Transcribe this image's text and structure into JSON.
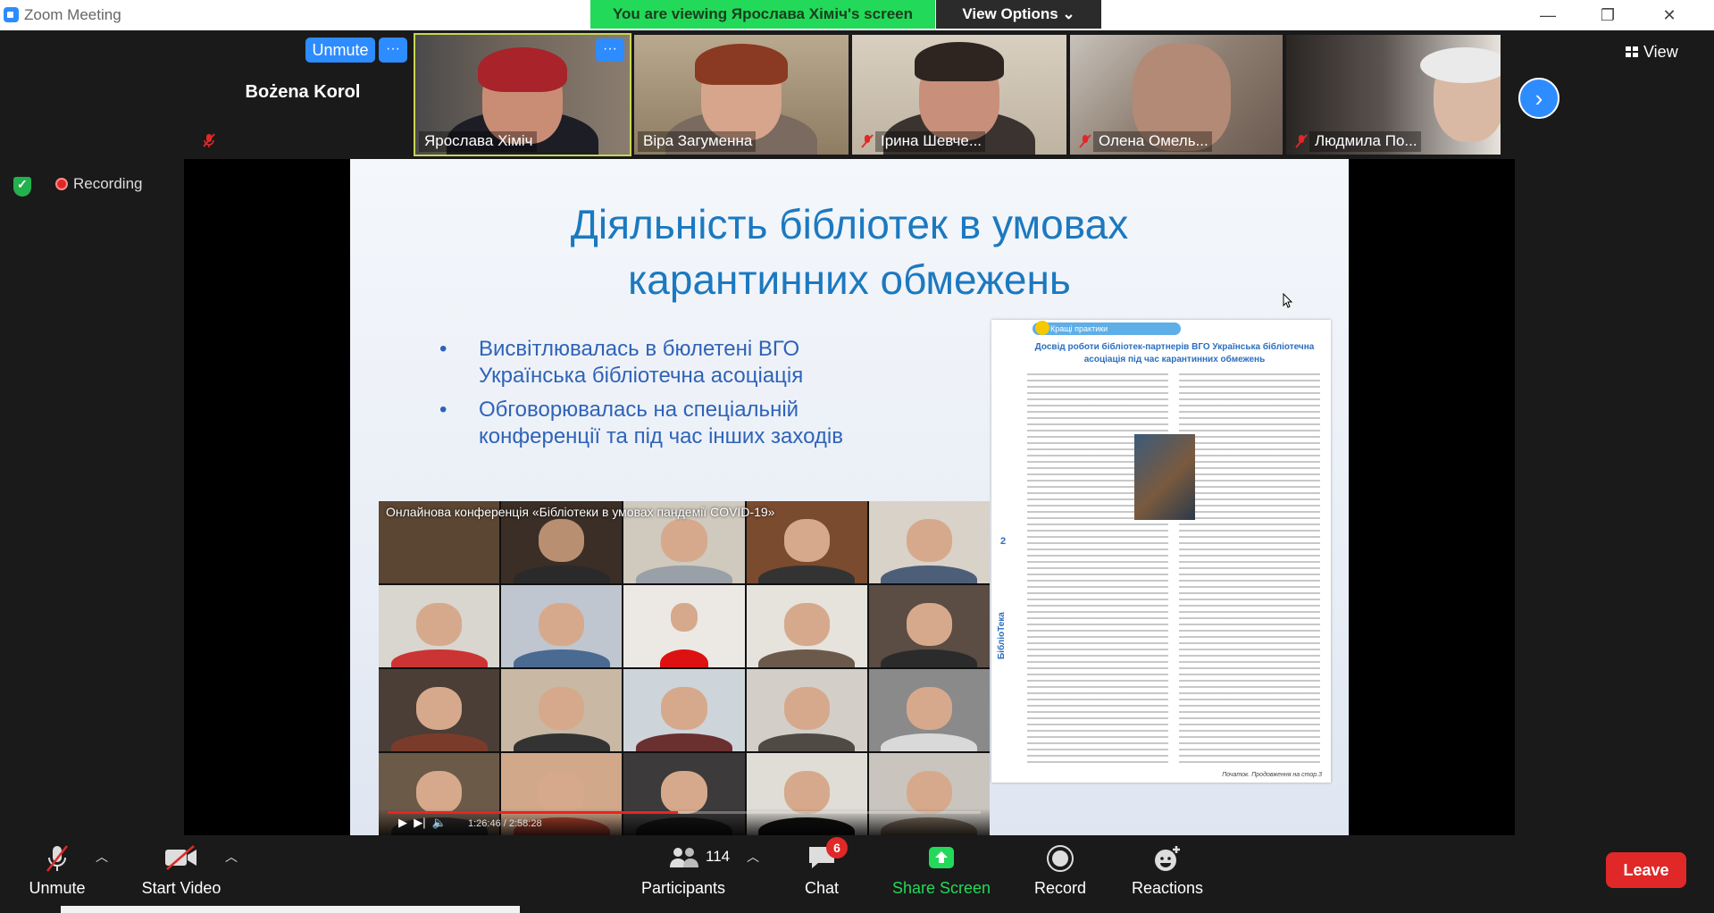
{
  "window": {
    "app_title": "Zoom Meeting",
    "viewing_banner": "You are viewing Ярослава Хіміч's screen",
    "view_options": "View Options ⌄"
  },
  "self_view": {
    "name": "Bożena Korol",
    "unmute_label": "Unmute",
    "more_label": "···"
  },
  "participants": [
    {
      "name": "Ярослава Хіміч",
      "muted": false,
      "active": true
    },
    {
      "name": "Віра Загуменна",
      "muted": false,
      "active": false
    },
    {
      "name": "Ірина Шевче...",
      "muted": true,
      "active": false
    },
    {
      "name": "Олена Омель...",
      "muted": true,
      "active": false
    },
    {
      "name": "Людмила По...",
      "muted": true,
      "active": false
    }
  ],
  "strip": {
    "next_label": "›",
    "view_label": "View"
  },
  "status": {
    "recording_label": "Recording"
  },
  "slide": {
    "title_line1": "Діяльність бібліотек в умовах",
    "title_line2": "карантинних обмежень",
    "bullets": [
      "Висвітлювалась в бюлетені ВГО Українська бібліотечна асоціація",
      "Обговорювалась на спеціальній конференції та під час інших заходів"
    ],
    "video": {
      "title": "Онлайнова конференція «Бібліотеки в умовах пандемії COVID-19»",
      "time": "1:26:46 / 2:58:28",
      "progress_fraction": 0.49
    },
    "newsletter": {
      "tag": "Кращі практики",
      "headline": "Досвід роботи бібліотек-партнерів ВГО Українська бібліотечна асоціація під час карантинних обмежень",
      "side_title": "БібліоТека",
      "page_number": "2",
      "footer": "Початок. Продовження на стор.3"
    }
  },
  "toolbar": {
    "unmute": "Unmute",
    "start_video": "Start Video",
    "participants": "Participants",
    "participants_count": "114",
    "chat": "Chat",
    "chat_badge": "6",
    "share_screen": "Share Screen",
    "record": "Record",
    "reactions": "Reactions",
    "leave": "Leave"
  },
  "colors": {
    "accent_blue": "#2d8cff",
    "share_green": "#23d959",
    "leave_red": "#e02828",
    "slide_title": "#1c79c0",
    "slide_text": "#2f63b8"
  }
}
